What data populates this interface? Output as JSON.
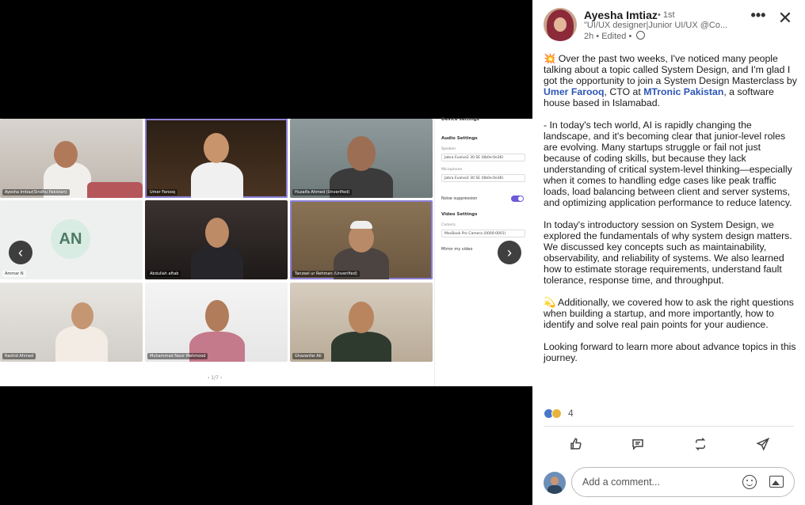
{
  "meeting": {
    "participants": [
      {
        "name": "Ayesha Imtiaz(Sindhu Pakistan)"
      },
      {
        "name": "Umer Farooq"
      },
      {
        "name": "Huzaifa Ahmed (Unverified)"
      },
      {
        "name": "Ammar N",
        "initials": "AN"
      },
      {
        "name": "Abdullah aftab"
      },
      {
        "name": "Tanzeel ur Rehman (Unverified)"
      },
      {
        "name": "Rashid Ahmed"
      },
      {
        "name": "Muhammad Nasir Mehmood"
      },
      {
        "name": "Ghazanfar Ali"
      }
    ],
    "pager": "‹ 1/7 ›",
    "prev_symbol": "‹",
    "next_symbol": "›"
  },
  "settings": {
    "title": "Device settings",
    "audio_heading": "Audio Settings",
    "speaker_label": "Speaker",
    "speaker_value": "Jabra Evolve2 30 SE (0b0e:0e36)",
    "mic_label": "Microphone",
    "mic_value": "Jabra Evolve2 30 SE (0b0e:0e36)",
    "noise_label": "Noise suppression",
    "video_heading": "Video Settings",
    "camera_label": "Camera",
    "camera_value": "MacBook Pro Camera (0000:0001)",
    "mirror_label": "Mirror my video"
  },
  "post": {
    "author": "Ayesha Imtiaz",
    "degree": "• 1st",
    "tagline": "\"UI/UX designer|Junior UI/UX @Co...",
    "time": "2h • Edited •",
    "p1_a": "💥 Over the past two weeks, I've noticed many people talking about a topic called System Design, and I'm glad I got the opportunity to join a System Design Masterclass by ",
    "mention1": "Umer Farooq",
    "p1_b": ", CTO at ",
    "mention2": "MTronic Pakistan",
    "p1_c": ", a software house based in Islamabad.",
    "p2": "- In today's tech world, AI is rapidly changing the landscape, and it's becoming clear that junior-level roles are evolving. Many startups struggle or fail not just because of coding skills, but because they lack understanding of critical system-level thinking—especially when it comes to handling edge cases like peak traffic loads, load balancing between client and server systems, and optimizing application performance to reduce latency.",
    "p3": "In today's introductory session on System Design, we explored the fundamentals of why system design matters. We discussed key concepts such as maintainability, observability, and reliability of systems. We also learned how to estimate storage requirements, understand fault tolerance, response time, and throughput.",
    "p4": "💫 Additionally, we covered how to ask the right questions when building a startup, and more importantly, how to identify and solve real pain points for your audience.",
    "p5": "Looking forward to learn more about advance topics in this journey.",
    "reaction_count": "4",
    "comment_placeholder": "Add a comment..."
  },
  "icons": {
    "more": "•••",
    "close": "✕",
    "like": "like-icon",
    "comment": "comment-icon",
    "repost": "repost-icon",
    "send": "send-icon"
  }
}
